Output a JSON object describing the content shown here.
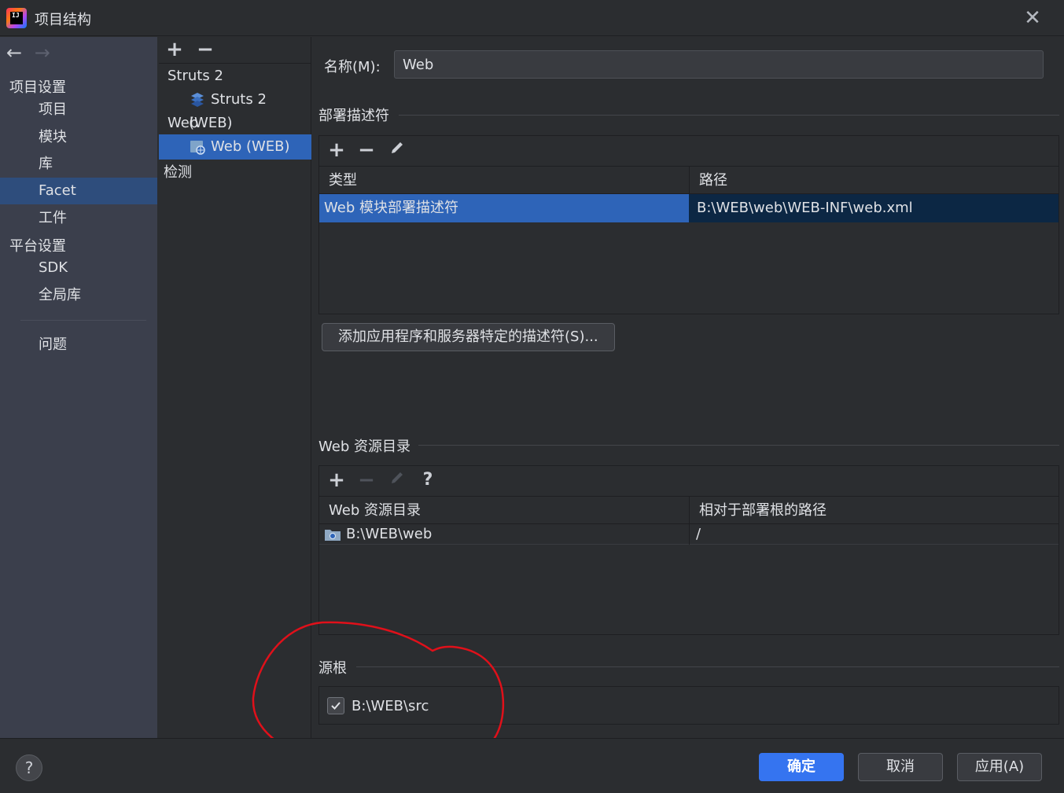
{
  "window": {
    "title": "项目结构",
    "close_icon": "close-icon"
  },
  "sidebar": {
    "back_icon": "←",
    "forward_icon": "→",
    "group_project": "项目设置",
    "items_project": [
      {
        "label": "项目"
      },
      {
        "label": "模块"
      },
      {
        "label": "库"
      },
      {
        "label": "Facet",
        "selected": true
      },
      {
        "label": "工件"
      }
    ],
    "group_platform": "平台设置",
    "items_platform": [
      {
        "label": "SDK"
      },
      {
        "label": "全局库"
      }
    ],
    "problems": "问题"
  },
  "facets": {
    "add": "+",
    "remove": "−",
    "groups": [
      {
        "label": "Struts 2",
        "child": "Struts 2 (WEB)"
      },
      {
        "label": "Web",
        "child": "Web (WEB)"
      }
    ],
    "detection": "检测"
  },
  "main": {
    "name_label": "名称(M):",
    "name_value": "Web",
    "deploy": {
      "title": "部署描述符",
      "columns": [
        "类型",
        "路径"
      ],
      "rows": [
        {
          "type": "Web 模块部署描述符",
          "path": "B:\\WEB\\web\\WEB-INF\\web.xml"
        }
      ],
      "add_server_button": "添加应用程序和服务器特定的描述符(S)..."
    },
    "resources": {
      "title": "Web 资源目录",
      "help": "?",
      "columns": [
        "Web 资源目录",
        "相对于部署根的路径"
      ],
      "rows": [
        {
          "dir": "B:\\WEB\\web",
          "rel": "/"
        }
      ]
    },
    "sources": {
      "title": "源根",
      "items": [
        {
          "path": "B:\\WEB\\src",
          "checked": true
        }
      ]
    }
  },
  "footer": {
    "help": "?",
    "ok": "确定",
    "cancel": "取消",
    "apply": "应用(A)"
  },
  "colors": {
    "accent": "#3574f0",
    "selection": "#2e64b8",
    "annotation": "#e0101a"
  }
}
